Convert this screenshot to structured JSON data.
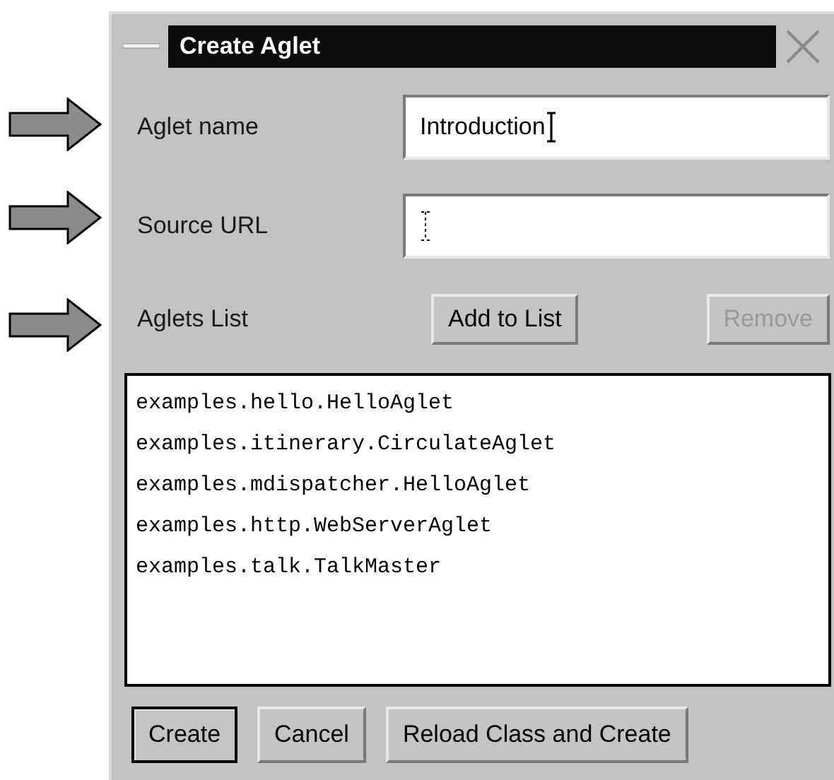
{
  "window": {
    "title": "Create Aglet"
  },
  "fields": [
    {
      "kind": "text",
      "label": "Aglet name",
      "value": "Introduction",
      "marked": true
    },
    {
      "kind": "text",
      "label": "Source URL",
      "marked": true
    },
    {
      "kind": "buttons",
      "label": "Aglets List",
      "marked": true,
      "buttons": [
        {
          "label": "Add to List",
          "disabled": false
        },
        {
          "label": "Remove",
          "disabled": true
        }
      ]
    }
  ],
  "aglets_list": [
    "examples.hello.HelloAglet",
    "examples.itinerary.CirculateAglet",
    "examples.mdispatcher.HelloAglet",
    "examples.http.WebServerAglet",
    "examples.talk.TalkMaster"
  ],
  "buttons": [
    {
      "label": "Create",
      "default": true
    },
    {
      "label": "Cancel",
      "default": false
    },
    {
      "label": "Reload Class and Create",
      "default": false
    }
  ]
}
